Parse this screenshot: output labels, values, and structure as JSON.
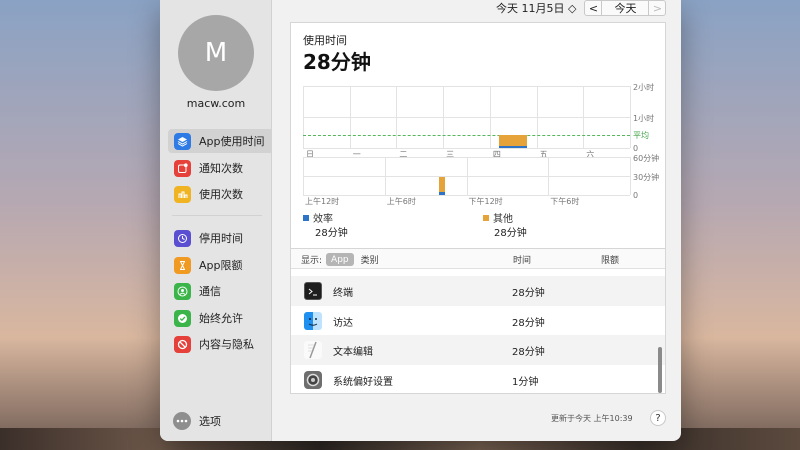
{
  "user": {
    "avatar_letter": "M",
    "name": "macw.com"
  },
  "sidebar": {
    "items": [
      {
        "label": "App使用时间",
        "icon": "layers-icon",
        "color": "#2f7be6",
        "active": true
      },
      {
        "label": "通知次数",
        "icon": "notification-icon",
        "color": "#e5403a"
      },
      {
        "label": "使用次数",
        "icon": "pickups-icon",
        "color": "#f0b423"
      },
      {
        "label": "停用时间",
        "icon": "downtime-icon",
        "color": "#5b4fd1"
      },
      {
        "label": "App限额",
        "icon": "hourglass-icon",
        "color": "#f19a22"
      },
      {
        "label": "通信",
        "icon": "contacts-icon",
        "color": "#3bb54a"
      },
      {
        "label": "始终允许",
        "icon": "checkmark-icon",
        "color": "#3bb54a"
      },
      {
        "label": "内容与隐私",
        "icon": "restriction-icon",
        "color": "#e5403a"
      }
    ],
    "options_label": "选项"
  },
  "nav": {
    "date_label": "今天 11月5日 ◇",
    "prev": "<",
    "today": "今天",
    "next": ">"
  },
  "usage": {
    "label": "使用时间",
    "value": "28分钟"
  },
  "chart_data": [
    {
      "type": "bar",
      "title": "",
      "categories": [
        "日",
        "一",
        "二",
        "三",
        "四",
        "五",
        "六"
      ],
      "y_ticks": [
        "2小时",
        "1小时",
        "0"
      ],
      "average_label": "平均",
      "series": [
        {
          "name": "效率",
          "color": "#2d73c8",
          "values": [
            0,
            0,
            0,
            0,
            0.08,
            0,
            0
          ]
        },
        {
          "name": "其他",
          "color": "#e6a33a",
          "values": [
            0,
            0,
            0,
            0,
            0.33,
            0,
            0
          ]
        }
      ]
    },
    {
      "type": "bar",
      "title": "",
      "x_tick_labels": [
        "上午12时",
        "上午6时",
        "下午12时",
        "下午6时"
      ],
      "y_ticks": [
        "60分钟",
        "30分钟",
        "0"
      ],
      "series": [
        {
          "name": "效率",
          "color": "#2d73c8",
          "values_minutes": [
            5
          ]
        },
        {
          "name": "其他",
          "color": "#e6a33a",
          "values_minutes": [
            23
          ]
        }
      ]
    }
  ],
  "legend": [
    {
      "name": "效率",
      "color": "#2d73c8",
      "value": "28分钟"
    },
    {
      "name": "其他",
      "color": "#e6a33a",
      "value": "28分钟"
    }
  ],
  "table": {
    "show_label": "显示:",
    "seg_app": "App",
    "seg_category": "类别",
    "col_time": "时间",
    "col_limit": "限额",
    "rows": [
      {
        "name": "终端",
        "time": "28分钟",
        "icon": "terminal-icon"
      },
      {
        "name": "访达",
        "time": "28分钟",
        "icon": "finder-icon"
      },
      {
        "name": "文本编辑",
        "time": "28分钟",
        "icon": "textedit-icon"
      },
      {
        "name": "系统偏好设置",
        "time": "1分钟",
        "icon": "system-preferences-icon"
      }
    ]
  },
  "footer": {
    "updated": "更新于今天 上午10:39",
    "help": "?"
  }
}
